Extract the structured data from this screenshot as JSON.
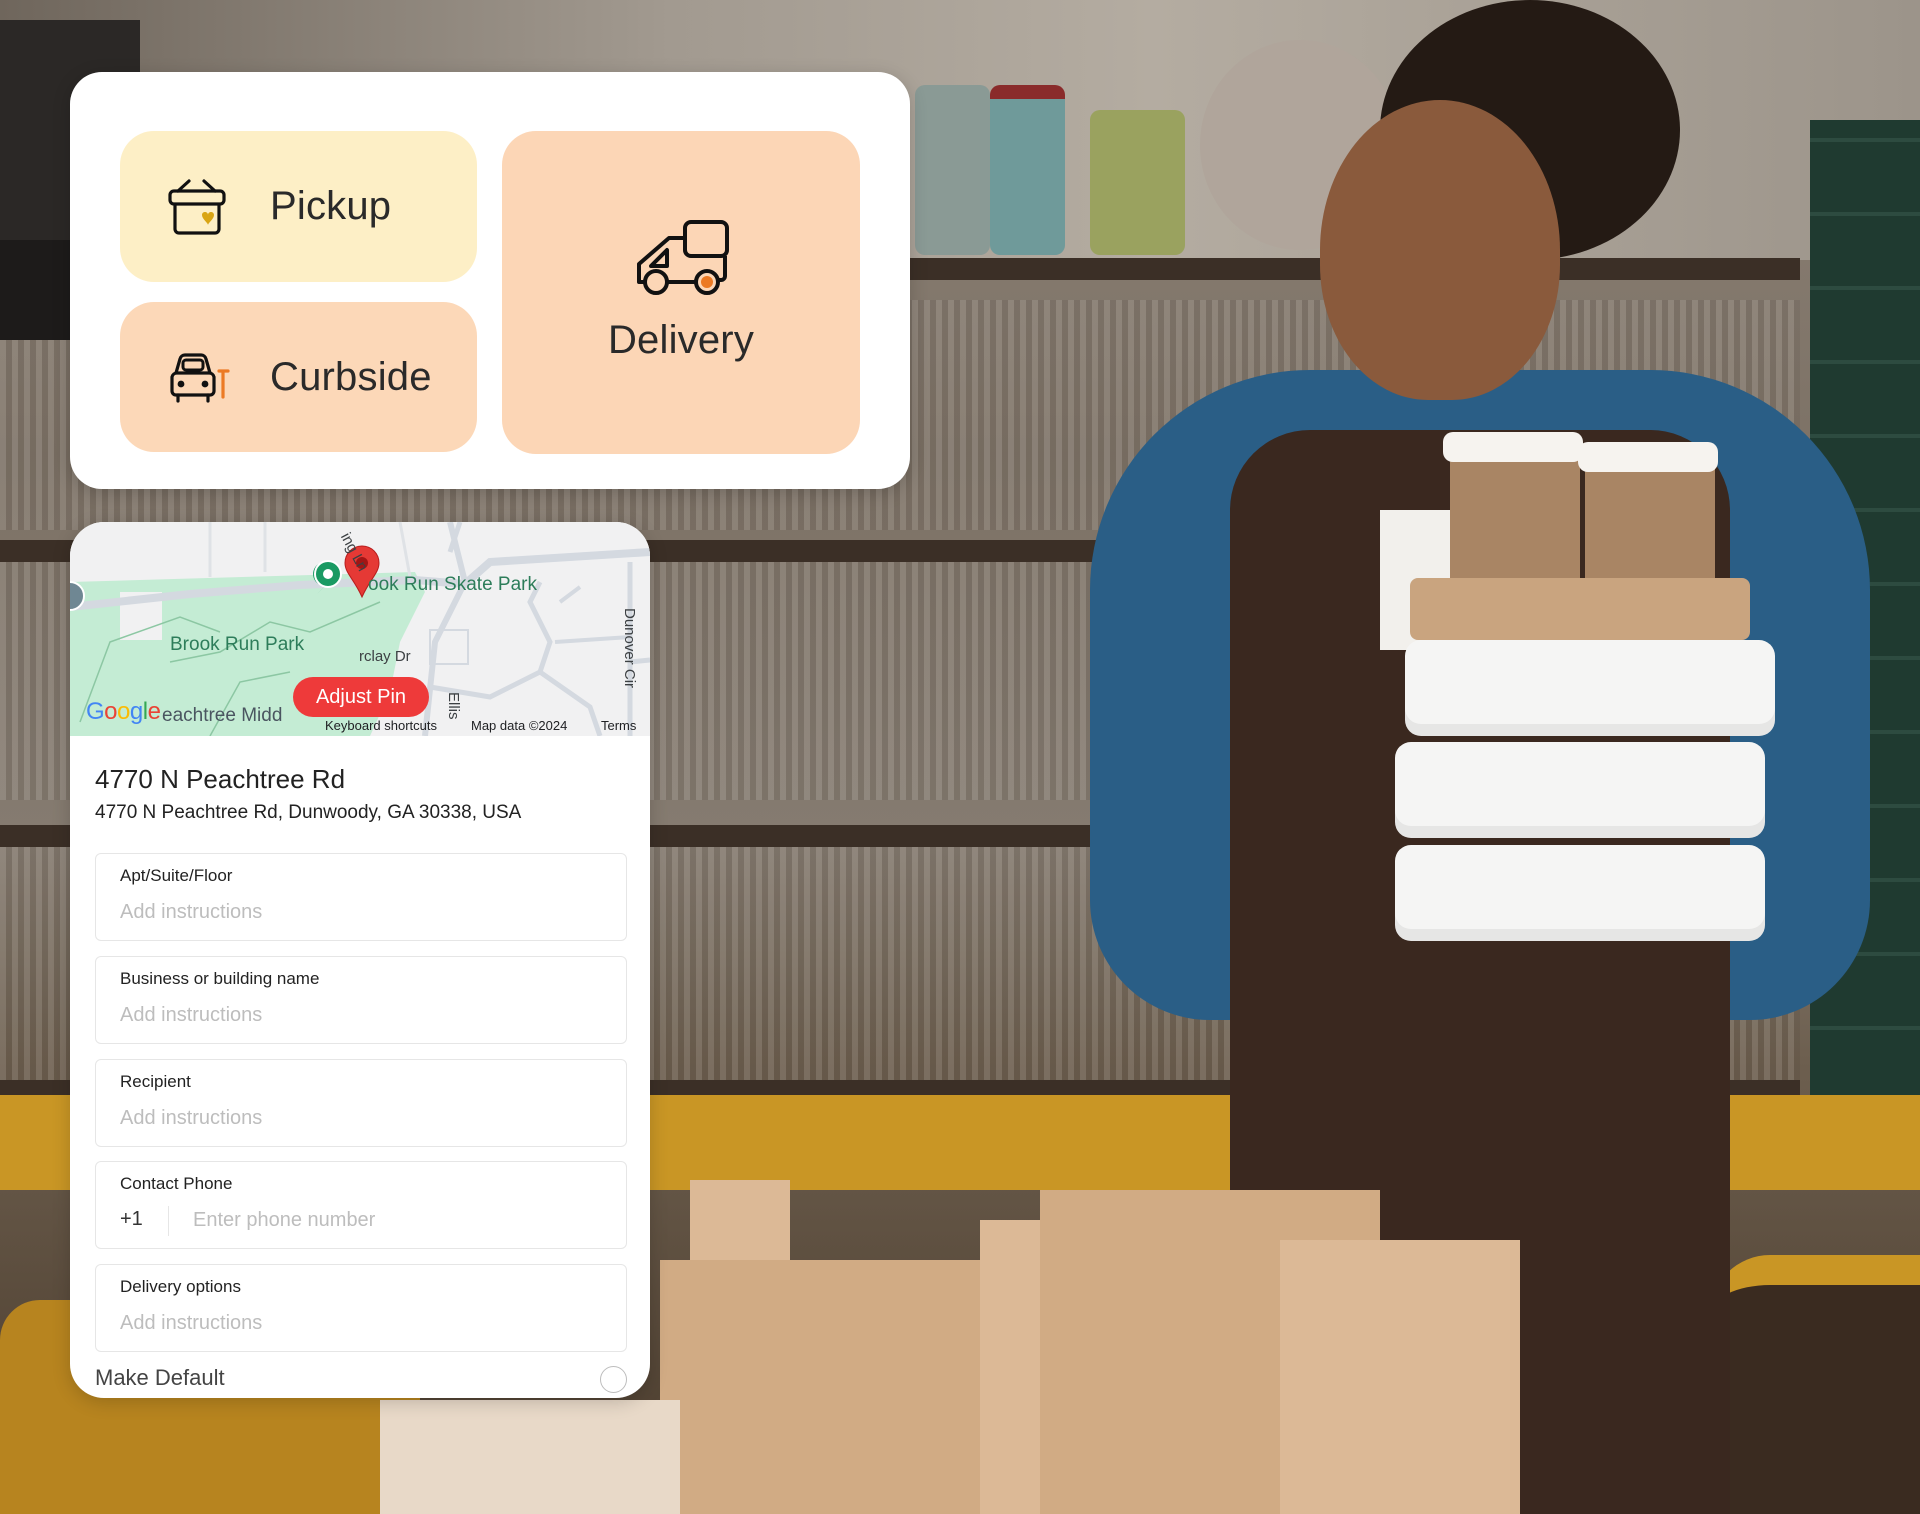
{
  "fulfillment_options": {
    "pickup": {
      "label": "Pickup",
      "icon": "pickup-bag-icon",
      "color": "#fdefc6"
    },
    "curbside": {
      "label": "Curbside",
      "icon": "car-icon",
      "color": "#fcd8b8"
    },
    "delivery": {
      "label": "Delivery",
      "icon": "delivery-van-icon",
      "color": "#fcd6b6"
    }
  },
  "map": {
    "labels": {
      "skate_park": "ook Run Skate Park",
      "park": "Brook Run Park",
      "school": "eachtree Midd",
      "road_ling": "ing Ln",
      "road_barclay": "rclay Dr",
      "road_dunover": "Dunover Cir",
      "road_ellis": "Ellis"
    },
    "adjust_pin_label": "Adjust Pin",
    "google_logo": "Google",
    "keyboard_shortcuts": "Keyboard shortcuts",
    "map_data": "Map data ©2024",
    "terms": "Terms",
    "pin_color": "#e53935"
  },
  "address": {
    "title": "4770 N Peachtree Rd",
    "full": "4770 N Peachtree Rd, Dunwoody, GA 30338, USA"
  },
  "fields": {
    "apt": {
      "label": "Apt/Suite/Floor",
      "placeholder": "Add instructions",
      "value": ""
    },
    "business": {
      "label": "Business or building name",
      "placeholder": "Add instructions",
      "value": ""
    },
    "recipient": {
      "label": "Recipient",
      "placeholder": "Add instructions",
      "value": ""
    },
    "phone": {
      "label": "Contact Phone",
      "country_code": "+1",
      "placeholder": "Enter phone number",
      "value": ""
    },
    "delivery_options": {
      "label": "Delivery options",
      "placeholder": "Add instructions",
      "value": ""
    }
  },
  "make_default": {
    "label": "Make Default",
    "checked": false
  },
  "colors": {
    "accent_red": "#ee3a3a",
    "delivery_orange": "#ec7a24",
    "heart_gold": "#d9a514"
  }
}
